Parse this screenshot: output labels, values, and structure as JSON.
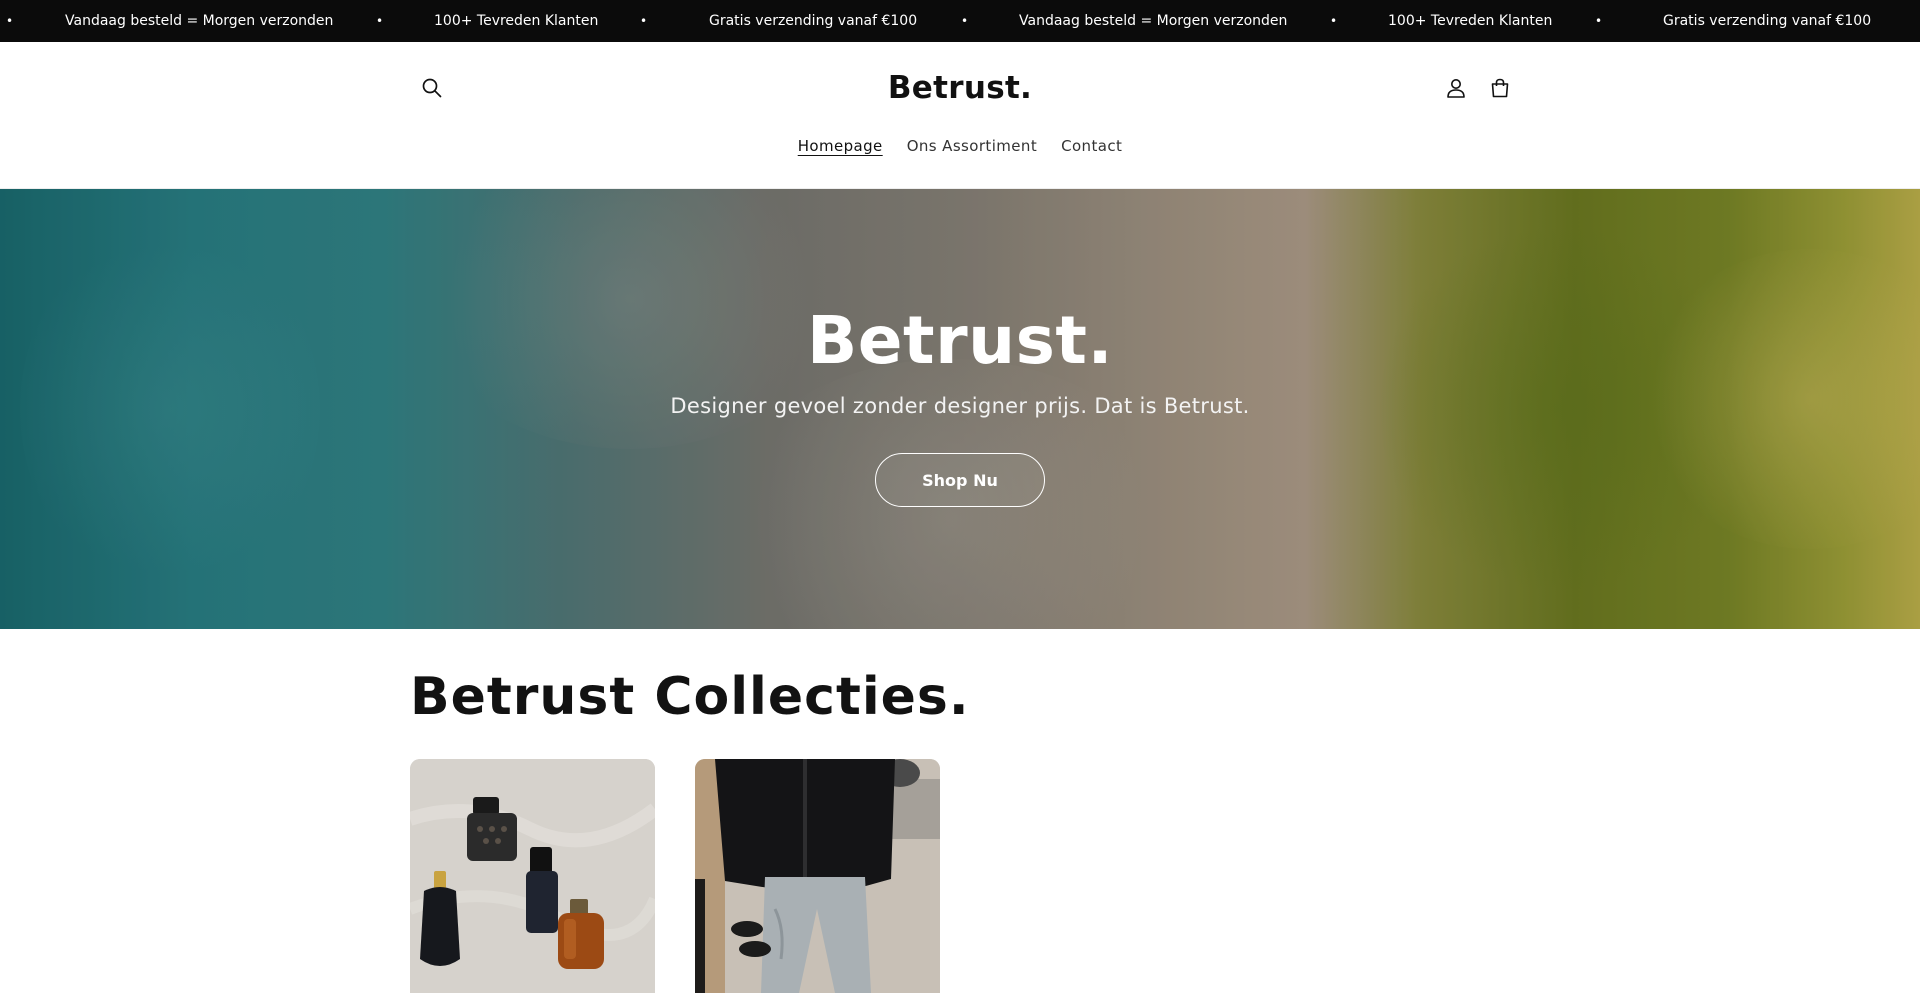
{
  "announcement": {
    "messages": [
      "Vandaag besteld = Morgen verzonden",
      "100+ Tevreden Klanten",
      "Gratis verzending vanaf €100",
      "Vandaag besteld = Morgen verzonden",
      "100+ Tevreden Klanten",
      "Gratis verzending vanaf €100"
    ],
    "separator": "•"
  },
  "header": {
    "logo": "Betrust.",
    "nav": [
      {
        "label": "Homepage",
        "active": true
      },
      {
        "label": "Ons Assortiment",
        "active": false
      },
      {
        "label": "Contact",
        "active": false
      }
    ],
    "icons": [
      "search-icon",
      "account-icon",
      "cart-icon"
    ]
  },
  "hero": {
    "title": "Betrust.",
    "subtitle": "Designer gevoel zonder designer prijs. Dat is Betrust.",
    "button_label": "Shop Nu"
  },
  "collections": {
    "title": "Betrust Collecties.",
    "cards": [
      {
        "image": "perfume-bottles-photo"
      },
      {
        "image": "outfit-jacket-jeans-photo"
      }
    ]
  },
  "colors": {
    "announcement_bg": "#0b0b0b",
    "text": "#121212",
    "hero_text": "#ffffff"
  }
}
